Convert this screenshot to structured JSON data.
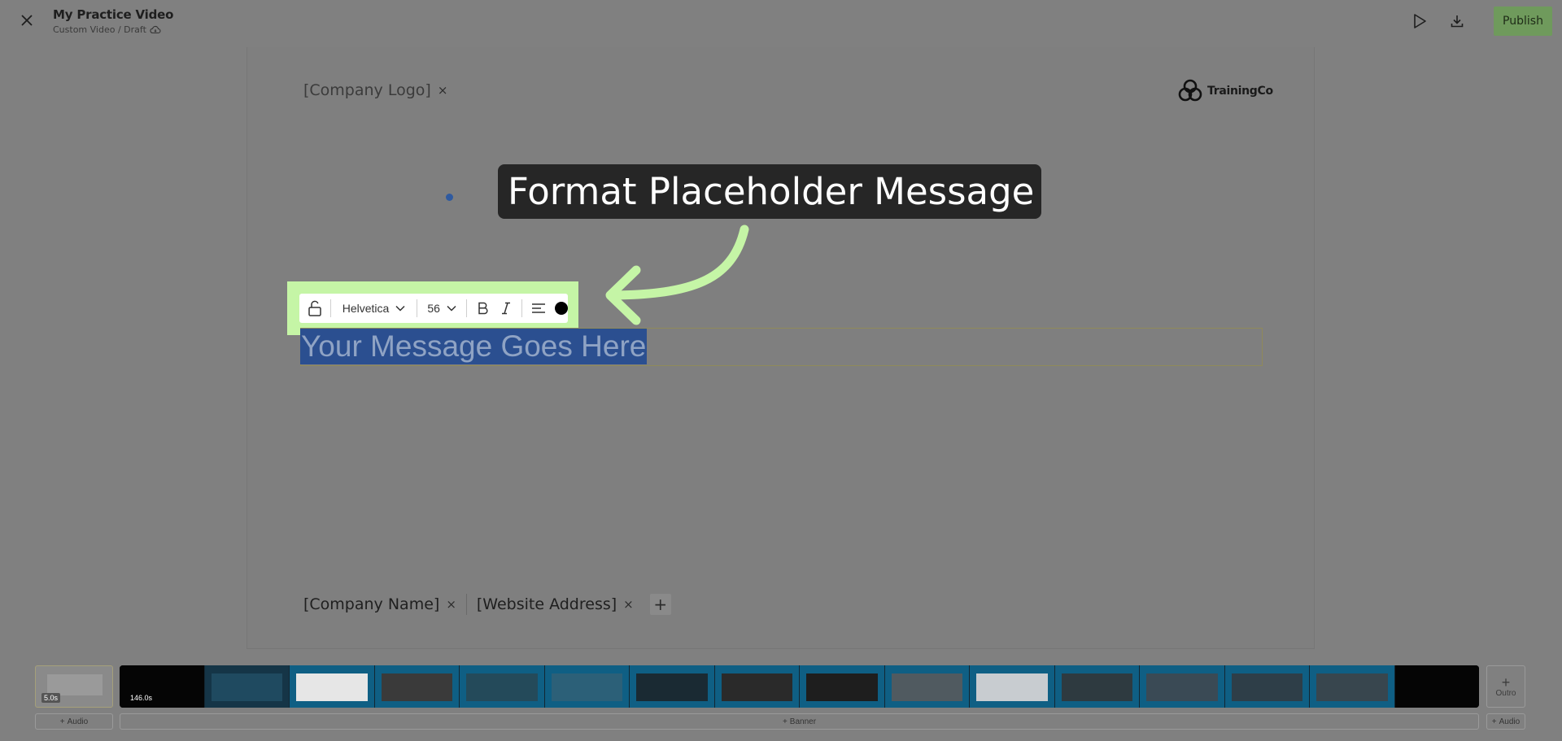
{
  "header": {
    "title": "My Practice Video",
    "subtitle": "Custom Video / Draft",
    "publish_label": "Publish",
    "icons": [
      "close-icon",
      "cloud-sync-icon",
      "play-icon",
      "download-icon"
    ]
  },
  "canvas": {
    "logo_placeholder": "[Company Logo]",
    "remove_symbol": "×",
    "brand_name": "TrainingCo",
    "callout_text": "Format Placeholder Message",
    "message_text": "Your Message Goes Here",
    "footer_items": [
      "[Company Name]",
      "[Website Address]"
    ],
    "add_symbol": "+"
  },
  "toolbar": {
    "font_name": "Helvetica",
    "font_size": "56",
    "text_color": "#000000",
    "icons": [
      "unlock-icon",
      "chevron-down-icon",
      "bold-icon",
      "italic-icon",
      "align-left-icon"
    ]
  },
  "timeline": {
    "intro_duration": "5.0s",
    "main_duration": "146.0s",
    "outro_label": "Outro",
    "add_audio_left": "Audio",
    "add_banner": "Banner",
    "add_audio_right": "Audio",
    "plus": "+"
  },
  "colors": {
    "highlight": "#c5f5a6",
    "arrow": "#c5f5a6",
    "selection": "#2b4f90",
    "publish": "#6f9a5c"
  }
}
